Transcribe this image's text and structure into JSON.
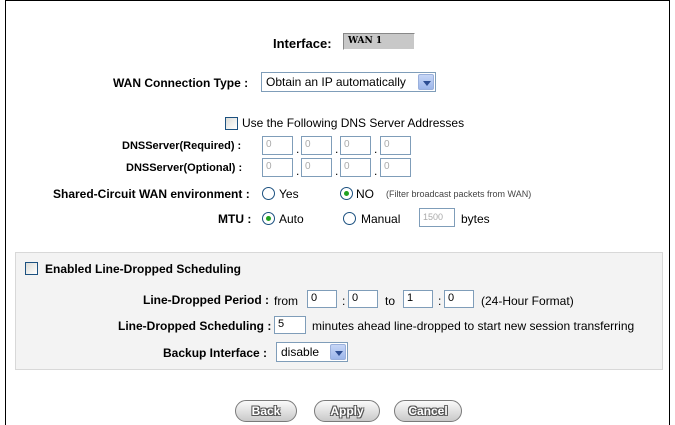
{
  "interface": {
    "label": "Interface:",
    "value": "WAN 1"
  },
  "wan_type": {
    "label": "WAN  Connection Type :",
    "value": "Obtain an IP automatically"
  },
  "dns": {
    "use_label": "Use the Following DNS Server Addresses",
    "required_label": "DNSServer(Required) :",
    "optional_label": "DNSServer(Optional) :",
    "required": [
      "0",
      "0",
      "0",
      "0"
    ],
    "optional": [
      "0",
      "0",
      "0",
      "0"
    ]
  },
  "shared": {
    "label": "Shared-Circuit WAN environment :",
    "yes": "Yes",
    "no": "NO",
    "note": "(Filter broadcast packets from WAN)"
  },
  "mtu": {
    "label": "MTU :",
    "auto": "Auto",
    "manual": "Manual",
    "value": "1500",
    "unit": "bytes"
  },
  "scheduling": {
    "enable_label": "Enabled Line-Dropped Scheduling",
    "period_label": "Line-Dropped Period :",
    "from": "from",
    "to": "to",
    "from_h": "0",
    "from_m": "0",
    "to_h": "1",
    "to_m": "0",
    "colon": ":",
    "format": "(24-Hour Format)",
    "sched_label": "Line-Dropped Scheduling :",
    "minutes": "5",
    "minutes_note": "minutes ahead line-dropped to start new session transferring",
    "backup_label": "Backup Interface :",
    "backup_value": "disable"
  },
  "buttons": {
    "back": "Back",
    "apply": "Apply",
    "cancel": "Cancel"
  }
}
